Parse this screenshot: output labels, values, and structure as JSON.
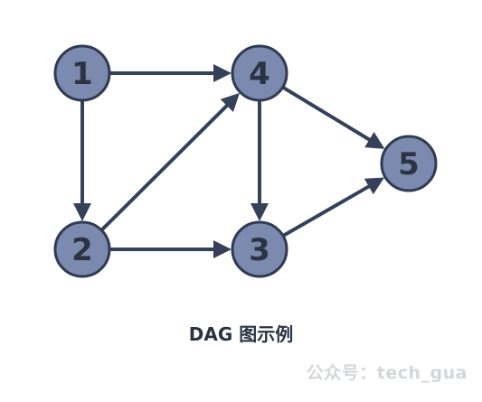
{
  "diagram": {
    "nodes": [
      {
        "id": "1",
        "label": "1"
      },
      {
        "id": "2",
        "label": "2"
      },
      {
        "id": "3",
        "label": "3"
      },
      {
        "id": "4",
        "label": "4"
      },
      {
        "id": "5",
        "label": "5"
      }
    ],
    "edges": [
      {
        "from": "1",
        "to": "4"
      },
      {
        "from": "1",
        "to": "2"
      },
      {
        "from": "2",
        "to": "4"
      },
      {
        "from": "2",
        "to": "3"
      },
      {
        "from": "4",
        "to": "3"
      },
      {
        "from": "4",
        "to": "5"
      },
      {
        "from": "3",
        "to": "5"
      }
    ],
    "colors": {
      "node_fill": "#7c8aaf",
      "node_stroke": "#2f3b52",
      "edge": "#344158",
      "label": "#2c3444"
    }
  },
  "caption": "DAG 图示例",
  "watermark": "公众号：tech_gua"
}
